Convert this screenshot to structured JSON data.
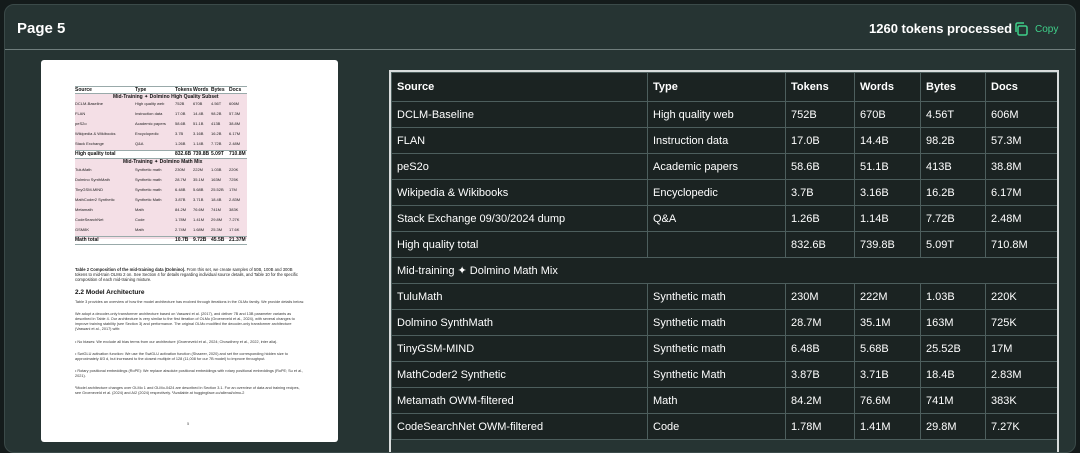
{
  "header": {
    "title": "Page 5",
    "status": "1260 tokens processed",
    "copy_label": "Copy"
  },
  "preview": {
    "mini_table": {
      "columns": [
        "Source",
        "Type",
        "Tokens",
        "Words",
        "Bytes",
        "Docs"
      ],
      "section1": "Mid-Training ✦ Dolmino High Quality Subset",
      "rows1": [
        [
          "DCLM-Baseline",
          "High quality web",
          "752B",
          "670B",
          "4.56T",
          "606M"
        ],
        [
          "FLAN",
          "Instruction data",
          "17.0B",
          "14.4B",
          "98.2B",
          "57.3M"
        ],
        [
          "peS2o",
          "Academic papers",
          "58.6B",
          "51.1B",
          "413B",
          "38.8M"
        ],
        [
          "Wikipedia & Wikibooks",
          "Encyclopedic",
          "3.7B",
          "3.16B",
          "16.2B",
          "6.17M"
        ],
        [
          "Stack Exchange",
          "Q&A",
          "1.26B",
          "1.14B",
          "7.72B",
          "2.48M"
        ]
      ],
      "total1": [
        "High quality total",
        "",
        "832.6B",
        "739.8B",
        "5.09T",
        "710.8M"
      ],
      "section2": "Mid-Training ✦ Dolmino Math Mix",
      "rows2": [
        [
          "TuluMath",
          "Synthetic math",
          "230M",
          "222M",
          "1.03B",
          "220K"
        ],
        [
          "Dolmino SynthMath",
          "Synthetic math",
          "28.7M",
          "35.1M",
          "163M",
          "725K"
        ],
        [
          "TinyGSM-MIND",
          "Synthetic math",
          "6.48B",
          "5.68B",
          "25.52B",
          "17M"
        ],
        [
          "MathCoder2 Synthetic",
          "Synthetic Math",
          "3.87B",
          "3.71B",
          "18.4B",
          "2.83M"
        ],
        [
          "Metamath",
          "Math",
          "84.2M",
          "76.6M",
          "741M",
          "383K"
        ],
        [
          "CodeSearchNet",
          "Code",
          "1.78M",
          "1.41M",
          "29.8M",
          "7.27K"
        ],
        [
          "GSM8K",
          "Math",
          "2.74M",
          "1.68M",
          "25.3M",
          "17.6K"
        ]
      ],
      "total2": [
        "Math total",
        "",
        "10.7B",
        "9.72B",
        "45.5B",
        "21.37M"
      ]
    },
    "caption_bold": "Table 2 Composition of the mid-training data (Dolmino).",
    "caption_rest": " From this set, we create samples of 50B, 100B and 300B tokens to mid-train OLMo 2 on. See Section 4 for details regarding individual source details, and Table 10 for the specific composition of each mid-training mixture.",
    "section_heading": "2.2  Model Architecture",
    "para1": "Table 3 provides an overview of how the model architecture has evolved through iterations in the OLMo family. We provide details below.",
    "para2": "We adopt a decoder-only transformer architecture based on Vaswani et al. (2017), and deliver 7B and 13B parameter variants as described in Table 4. Our architecture is very similar to the first iteration of OLMo (Groeneveld et al., 2024), with several changes to improve training stability (see Section 3) and performance. The original OLMo modified the decoder-only transformer architecture (Vaswani et al., 2017) with:",
    "bullet1": "• No biases: We exclude all bias terms from our architecture (Groeneveld et al., 2024; Chowdhery et al., 2022, inter alia).",
    "bullet2": "• SwiGLU activation function: We use the SwiGLU activation function (Shazeer, 2020) and set the corresponding hidden size to approximately 8/3 d, but increased to the closest multiple of 128 (11,008 for our 7B model) to improve throughput.",
    "bullet3": "• Rotary positional embeddings (RoPE): We replace absolute positional embeddings with rotary positional embeddings (RoPE; Su et al., 2021).",
    "footnote": "¹Model architecture changes over OLMo 1 and OLMo-0424 are described in Section 3.1. For an overview of data and training recipes, see Groeneveld et al. (2024) and AI2 (2024) respectively. ²Available at huggingface.co/allenai/olmo-2",
    "page_number": "5"
  },
  "table": {
    "columns": [
      "Source",
      "Type",
      "Tokens",
      "Words",
      "Bytes",
      "Docs"
    ],
    "rows": [
      {
        "cells": [
          "DCLM-Baseline",
          "High quality web",
          "752B",
          "670B",
          "4.56T",
          "606M"
        ]
      },
      {
        "cells": [
          "FLAN",
          "Instruction data",
          "17.0B",
          "14.4B",
          "98.2B",
          "57.3M"
        ]
      },
      {
        "cells": [
          "peS2o",
          "Academic papers",
          "58.6B",
          "51.1B",
          "413B",
          "38.8M"
        ]
      },
      {
        "cells": [
          "Wikipedia & Wikibooks",
          "Encyclopedic",
          "3.7B",
          "3.16B",
          "16.2B",
          "6.17M"
        ]
      },
      {
        "cells": [
          "Stack Exchange 09/30/2024 dump",
          "Q&A",
          "1.26B",
          "1.14B",
          "7.72B",
          "2.48M"
        ]
      },
      {
        "cells": [
          "High quality total",
          "",
          "832.6B",
          "739.8B",
          "5.09T",
          "710.8M"
        ]
      },
      {
        "section": "Mid-training ✦ Dolmino Math Mix"
      },
      {
        "cells": [
          "TuluMath",
          "Synthetic math",
          "230M",
          "222M",
          "1.03B",
          "220K"
        ]
      },
      {
        "cells": [
          "Dolmino SynthMath",
          "Synthetic math",
          "28.7M",
          "35.1M",
          "163M",
          "725K"
        ]
      },
      {
        "cells": [
          "TinyGSM-MIND",
          "Synthetic math",
          "6.48B",
          "5.68B",
          "25.52B",
          "17M"
        ]
      },
      {
        "cells": [
          "MathCoder2 Synthetic",
          "Synthetic Math",
          "3.87B",
          "3.71B",
          "18.4B",
          "2.83M"
        ]
      },
      {
        "cells": [
          "Metamath OWM-filtered",
          "Math",
          "84.2M",
          "76.6M",
          "741M",
          "383K"
        ]
      },
      {
        "cells": [
          "CodeSearchNet OWM-filtered",
          "Code",
          "1.78M",
          "1.41M",
          "29.8M",
          "7.27K"
        ]
      }
    ]
  },
  "colors": {
    "background": "#263433",
    "accent": "#3fd08a"
  }
}
